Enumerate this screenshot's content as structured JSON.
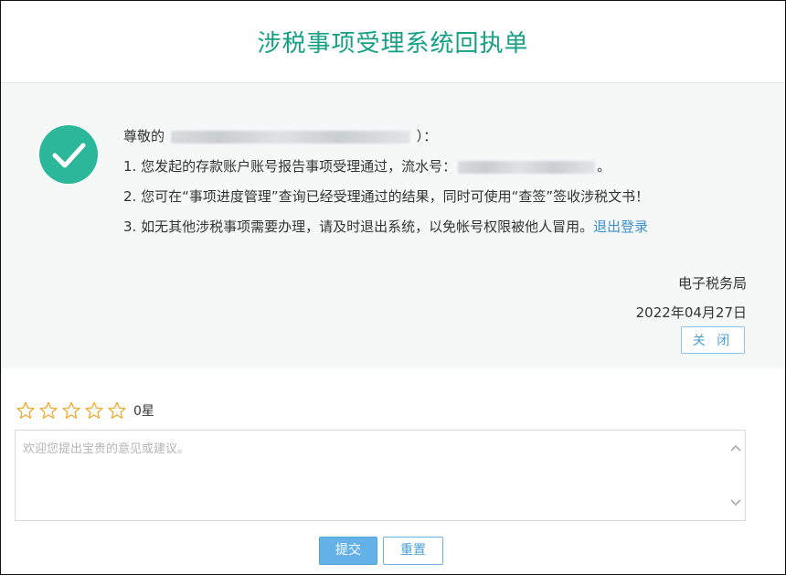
{
  "header": {
    "title": "涉税事项受理系统回执单"
  },
  "receipt": {
    "greeting_prefix": "尊敬的",
    "greeting_suffix": "）：",
    "line1_prefix": "1. 您发起的存款账户账号报告事项受理通过，流水号：",
    "line1_suffix": "。",
    "line2": "2. 您可在“事项进度管理”查询已经受理通过的结果，同时可使用“查签”签收涉税文书！",
    "line3_prefix": "3. 如无其他涉税事项需要办理，请及时退出系统，以免帐号权限被他人冒用。",
    "logout_link": "退出登录",
    "signature_office": "电子税务局",
    "signature_date": "2022年04月27日",
    "close_button": "关 闭"
  },
  "feedback": {
    "stars_total": 5,
    "rating": 0,
    "rating_label": "0星",
    "placeholder": "欢迎您提出宝贵的意见或建议。",
    "value": ""
  },
  "actions": {
    "submit": "提交",
    "reset": "重置"
  },
  "colors": {
    "title": "#16a085",
    "check_circle": "#2bb89a",
    "link": "#3b8fd4",
    "star_outline": "#f0a92e",
    "primary_button": "#63b1e6"
  },
  "icons": {
    "success": "check-circle-icon",
    "star": "star-outline-icon",
    "scroll_up": "chevron-up-icon",
    "scroll_down": "chevron-down-icon"
  }
}
